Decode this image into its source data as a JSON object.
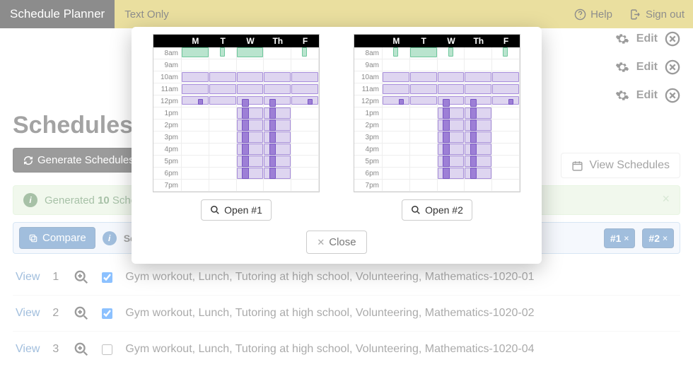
{
  "brand": "Schedule Planner",
  "text_only": "Text Only",
  "help": "Help",
  "sign_out": "Sign out",
  "edit_label": "Edit",
  "schedules_title": "Schedules",
  "generate_label": "Generate Schedules",
  "view_schedules_label": "View Schedules",
  "alert": {
    "prefix": "Generated ",
    "count": "10",
    "suffix": " Schedules"
  },
  "compare": {
    "button": "Compare",
    "select_label": "Select",
    "chips": [
      "#1",
      "#2"
    ]
  },
  "rows": [
    {
      "view": "View",
      "n": "1",
      "checked": true,
      "desc": "Gym workout, Lunch, Tutoring at high school, Volunteering, Mathematics-1020-01"
    },
    {
      "view": "View",
      "n": "2",
      "checked": true,
      "desc": "Gym workout, Lunch, Tutoring at high school, Volunteering, Mathematics-1020-02"
    },
    {
      "view": "View",
      "n": "3",
      "checked": false,
      "desc": "Gym workout, Lunch, Tutoring at high school, Volunteering, Mathematics-1020-04"
    }
  ],
  "calendar": {
    "days": [
      "M",
      "T",
      "W",
      "Th",
      "F"
    ],
    "times": [
      "8am",
      "9am",
      "10am",
      "11am",
      "12pm",
      "1pm",
      "2pm",
      "3pm",
      "4pm",
      "5pm",
      "6pm",
      "7pm"
    ]
  },
  "modal": {
    "open1": "Open #1",
    "open2": "Open #2",
    "close": "Close"
  }
}
